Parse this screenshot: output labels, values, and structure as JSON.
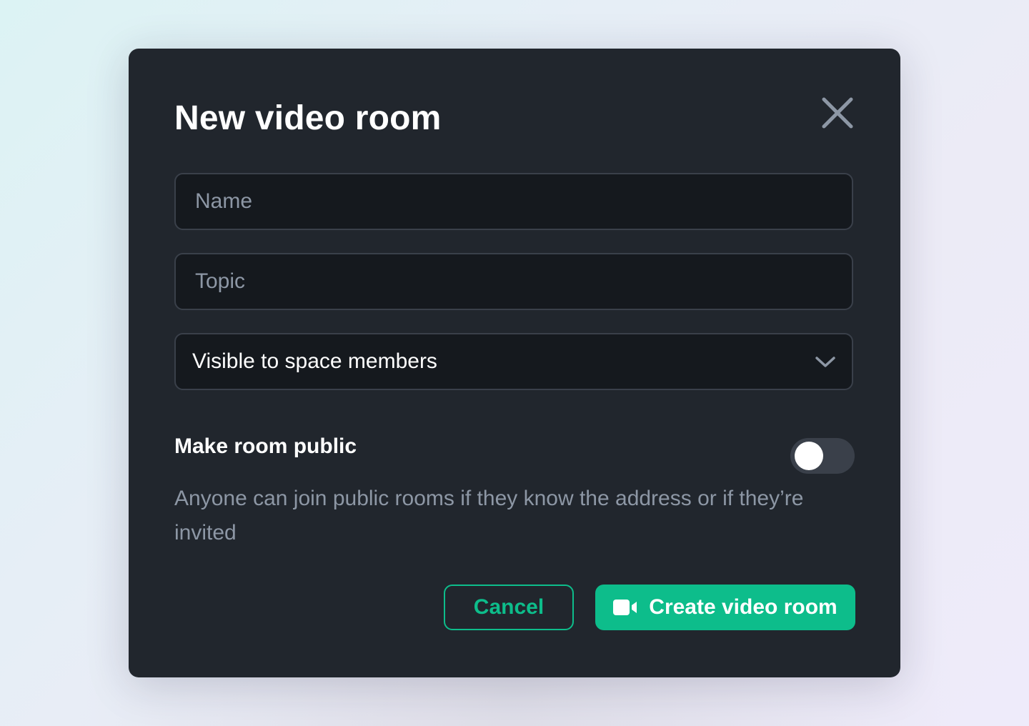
{
  "dialog": {
    "title": "New video room",
    "close_label": "Close"
  },
  "form": {
    "name": {
      "placeholder": "Name",
      "value": ""
    },
    "topic": {
      "placeholder": "Topic",
      "value": ""
    },
    "visibility": {
      "selected": "Visible to space members"
    },
    "public_toggle": {
      "label": "Make room public",
      "enabled": false,
      "description": "Anyone can join public rooms if they know the address or if they’re invited"
    }
  },
  "actions": {
    "cancel_label": "Cancel",
    "create_label": "Create video room"
  },
  "colors": {
    "accent": "#0dbd8b",
    "dialog_bg": "#21262d",
    "field_bg": "#15191e",
    "muted_text": "#8d97a5"
  },
  "icons": {
    "close": "close-icon",
    "chevron": "chevron-down-icon",
    "video": "video-camera-icon"
  }
}
